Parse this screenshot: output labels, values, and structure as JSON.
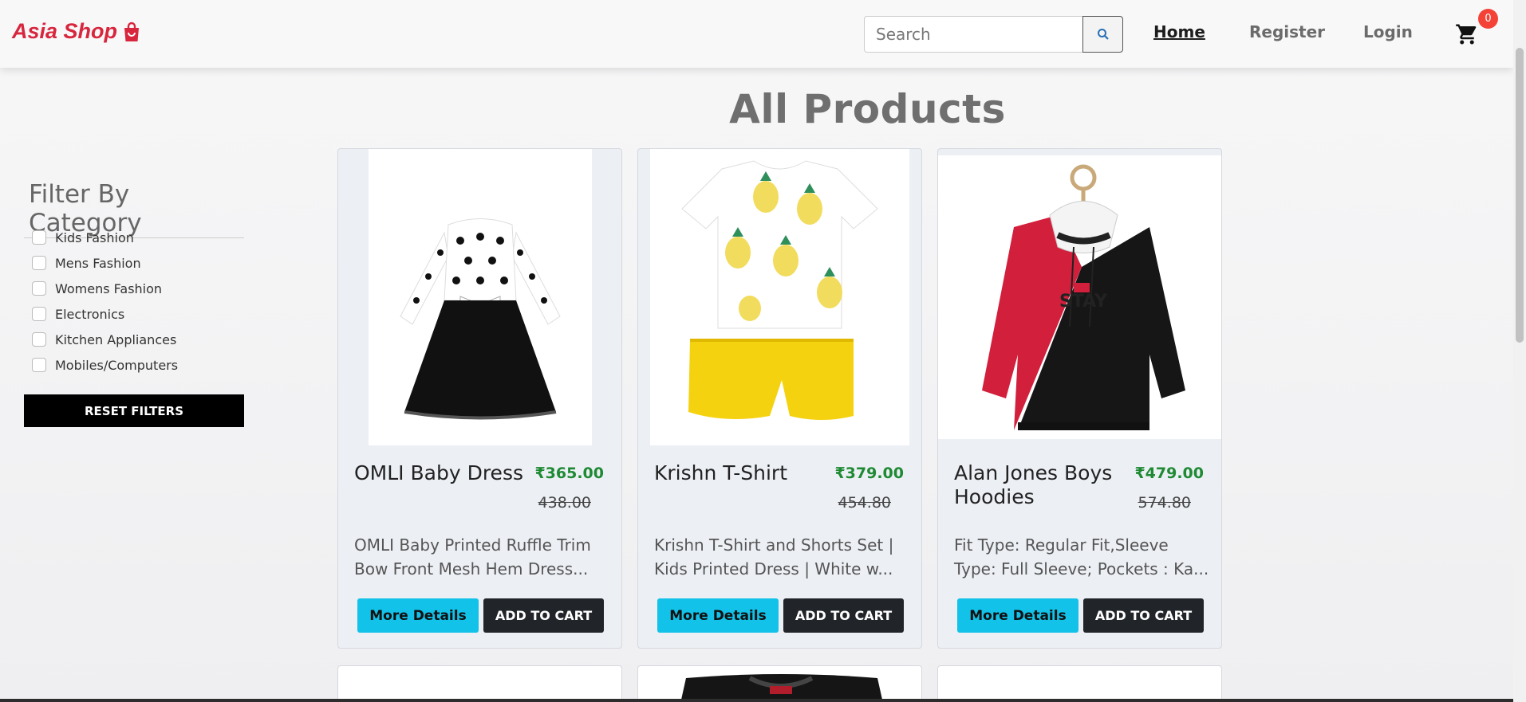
{
  "navbar": {
    "brand": "Asia Shop",
    "search_placeholder": "Search",
    "links": [
      "Home",
      "Register",
      "Login"
    ],
    "cart_count": "0"
  },
  "page_title": "All Products",
  "sidebar": {
    "title": "Filter By Category",
    "categories": [
      "Kids Fashion",
      "Mens Fashion",
      "Womens Fashion",
      "Electronics",
      "Kitchen Appliances",
      "Mobiles/Computers"
    ],
    "reset_label": "RESET FILTERS"
  },
  "products": [
    {
      "name": "OMLI Baby Dress",
      "price": "₹365.00",
      "old_price": "438.00",
      "description": "OMLI Baby Printed Ruffle Trim Bow Front Mesh Hem Dress...",
      "details_label": "More Details",
      "cart_label": "ADD TO CART"
    },
    {
      "name": "Krishn T-Shirt",
      "price": "₹379.00",
      "old_price": "454.80",
      "description": "Krishn T-Shirt and Shorts Set | Kids Printed Dress | White w...",
      "details_label": "More Details",
      "cart_label": "ADD TO CART"
    },
    {
      "name": "Alan Jones Boys Hoodies",
      "price": "₹479.00",
      "old_price": "574.80",
      "description": "Fit Type: Regular Fit,Sleeve Type: Full Sleeve; Pockets : Ka...",
      "details_label": "More Details",
      "cart_label": "ADD TO CART"
    }
  ],
  "colors": {
    "brand": "#d7263d",
    "price": "#1f8a34",
    "details_button": "#12c2e9",
    "cart_button": "#212529",
    "badge": "#f44336"
  },
  "icons": [
    "shopping-bag-icon",
    "search-icon",
    "cart-icon"
  ]
}
